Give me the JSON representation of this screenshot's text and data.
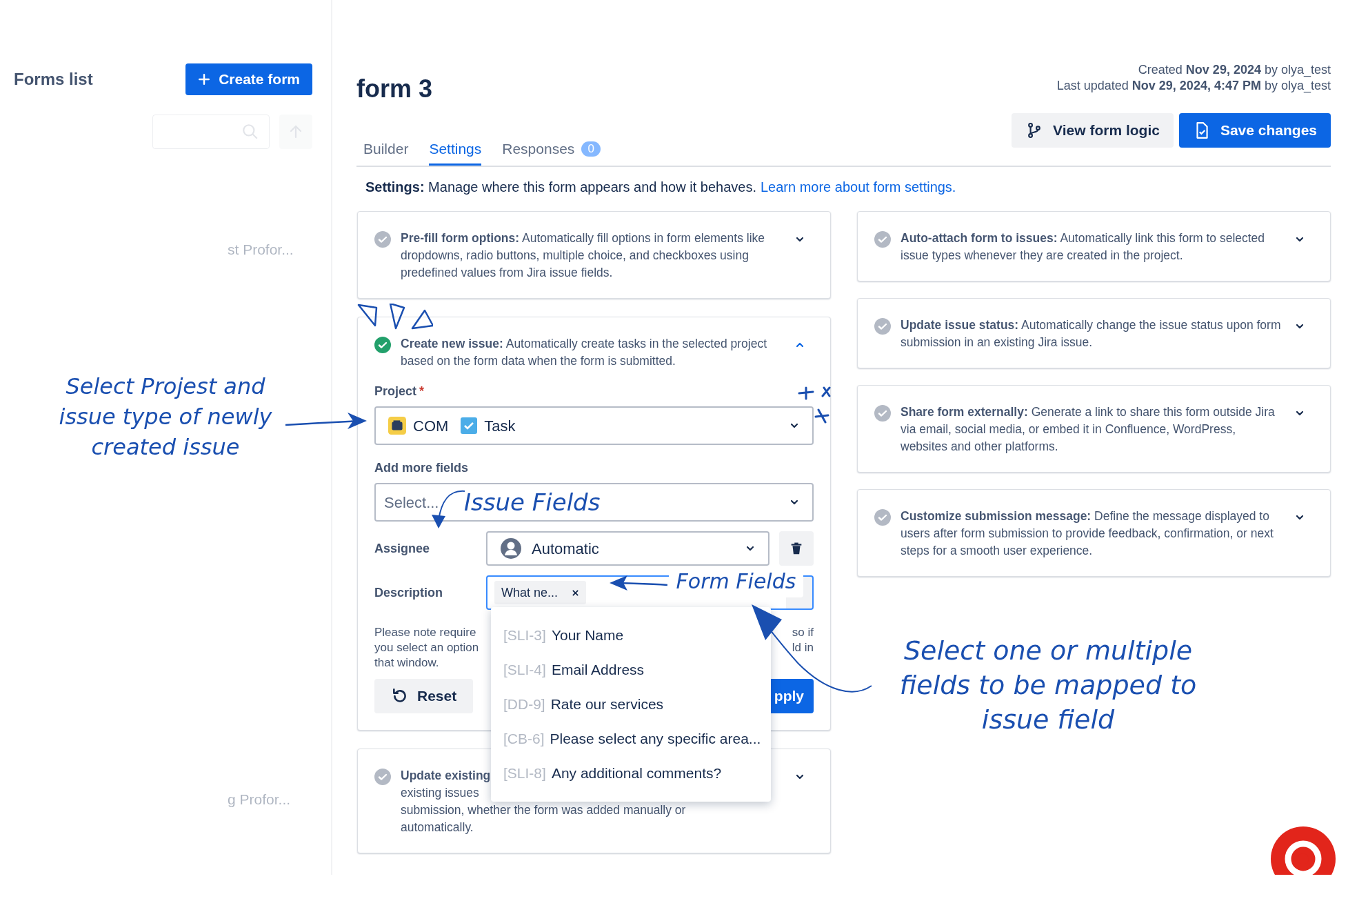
{
  "sidebar": {
    "title": "Forms list",
    "create_button": "Create form",
    "faded_items": [
      "st Profor...",
      "g Profor..."
    ]
  },
  "header": {
    "title": "form 3",
    "created": "Created **Nov 29, 2024** by olya_test",
    "updated": "Last updated **Nov 29, 2024, 4:47 PM** by olya_test"
  },
  "tabs": [
    {
      "label": "Builder",
      "selected": false
    },
    {
      "label": "Settings",
      "selected": true
    },
    {
      "label": "Responses",
      "selected": false,
      "count": "0"
    }
  ],
  "actions": [
    {
      "label": "View form logic",
      "kind": "secondary"
    },
    {
      "label": "Save changes",
      "kind": "primary"
    }
  ],
  "intro": {
    "text": "**Settings:** Manage where this form appears and how it behaves.",
    "link": "Learn more about form settings."
  },
  "left_cards": [
    {
      "title": "Pre-fill form options:",
      "text": "Automatically fill options in form elements like dropdowns, radio buttons, multiple choice, and checkboxes using predefined values from Jira issue fields.",
      "enabled": false,
      "expanded": false
    },
    {
      "title": "Create new issue:",
      "text": "Automatically create tasks in the selected project based on the form data when the form is submitted.",
      "enabled": true,
      "expanded": true
    },
    {
      "title": "Update existing",
      "lines": [
        "existing issues",
        "submission, whether the form was added manually or",
        "automatically."
      ],
      "enabled": false,
      "expanded": false
    }
  ],
  "create_issue": {
    "project": {
      "label": "Project",
      "required_mark": "*",
      "values": [
        {
          "kind": "project",
          "text": "COM"
        },
        {
          "kind": "task",
          "text": "Task"
        }
      ]
    },
    "add_more": {
      "label": "Add more fields",
      "placeholder": "Select..."
    },
    "rows": [
      {
        "label": "Assignee",
        "kind": "select",
        "value": "Automatic"
      },
      {
        "label": "Description",
        "kind": "chips",
        "chips": [
          "What ne..."
        ]
      }
    ],
    "note": {
      "left": [
        "Please note require",
        "you select an option",
        "that window."
      ],
      "right": [
        "so if",
        "ld in"
      ]
    },
    "reset": "Reset",
    "apply": "pply"
  },
  "dropdown": [
    {
      "code": "[SLI-3]",
      "label": "Your Name"
    },
    {
      "code": "[SLI-4]",
      "label": "Email Address"
    },
    {
      "code": "[DD-9]",
      "label": "Rate our services"
    },
    {
      "code": "[CB-6]",
      "label": "Please select any specific area..."
    },
    {
      "code": "[SLI-8]",
      "label": "Any additional comments?"
    }
  ],
  "right_cards": [
    {
      "title": "Auto-attach form to issues:",
      "text": "Automatically link this form to selected issue types whenever they are created in the project.",
      "enabled": false,
      "expanded": false
    },
    {
      "title": "Update issue status:",
      "text": "Automatically change the issue status upon form submission in an existing Jira issue.",
      "enabled": false,
      "expanded": false
    },
    {
      "title": "Share form externally:",
      "text": "Generate a link to share this form outside Jira via email, social media, or embed it in Confluence, WordPress, websites and other platforms.",
      "enabled": false,
      "expanded": false
    },
    {
      "title": "Customize submission message:",
      "text": "Define the message displayed to users after form submission to provide feedback, confirmation, or next steps for a smooth user experience.",
      "enabled": false,
      "expanded": false
    }
  ],
  "annotations": [
    {
      "text": "Select Projest and issue type of newly created issue"
    },
    {
      "text": "Issue Fields"
    },
    {
      "text": "Form Fields"
    },
    {
      "text": "Select one or multiple fields to be mapped to issue field"
    }
  ]
}
